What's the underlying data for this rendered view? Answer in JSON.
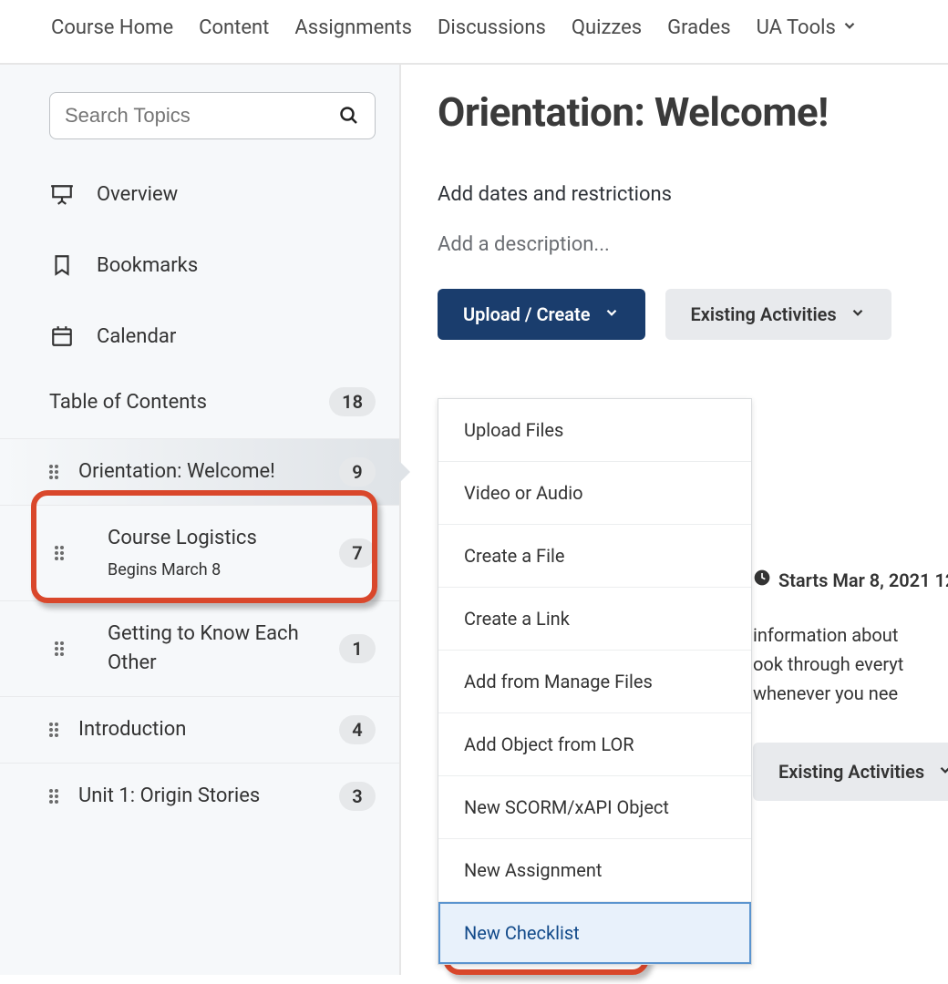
{
  "nav": {
    "items": [
      "Course Home",
      "Content",
      "Assignments",
      "Discussions",
      "Quizzes",
      "Grades",
      "UA Tools"
    ]
  },
  "sidebar": {
    "search_placeholder": "Search Topics",
    "overview": "Overview",
    "bookmarks": "Bookmarks",
    "calendar": "Calendar",
    "toc_label": "Table of Contents",
    "toc_count": "18",
    "modules": [
      {
        "title": "Orientation: Welcome!",
        "count": "9",
        "active": true,
        "sub": ""
      },
      {
        "title": "Course Logistics",
        "sub": "Begins March 8",
        "count": "7"
      },
      {
        "title": "Getting to Know Each Other",
        "count": "1"
      },
      {
        "title": "Introduction",
        "count": "4"
      },
      {
        "title": "Unit 1: Origin Stories",
        "count": "3"
      }
    ]
  },
  "main": {
    "title": "Orientation: Welcome!",
    "dates_text": "Add dates and restrictions",
    "desc_text": "Add a description...",
    "upload_create": "Upload / Create",
    "existing_activities": "Existing Activities",
    "dropdown": [
      "Upload Files",
      "Video or Audio",
      "Create a File",
      "Create a Link",
      "Add from Manage Files",
      "Add Object from LOR",
      "New SCORM/xAPI Object",
      "New Assignment",
      "New Checklist"
    ],
    "behind": {
      "starts": "Starts Mar 8, 2021 12:",
      "para1": "information about",
      "para2": "ook through everyt",
      "para3": "whenever you nee",
      "existing_activities": "Existing Activities"
    }
  }
}
